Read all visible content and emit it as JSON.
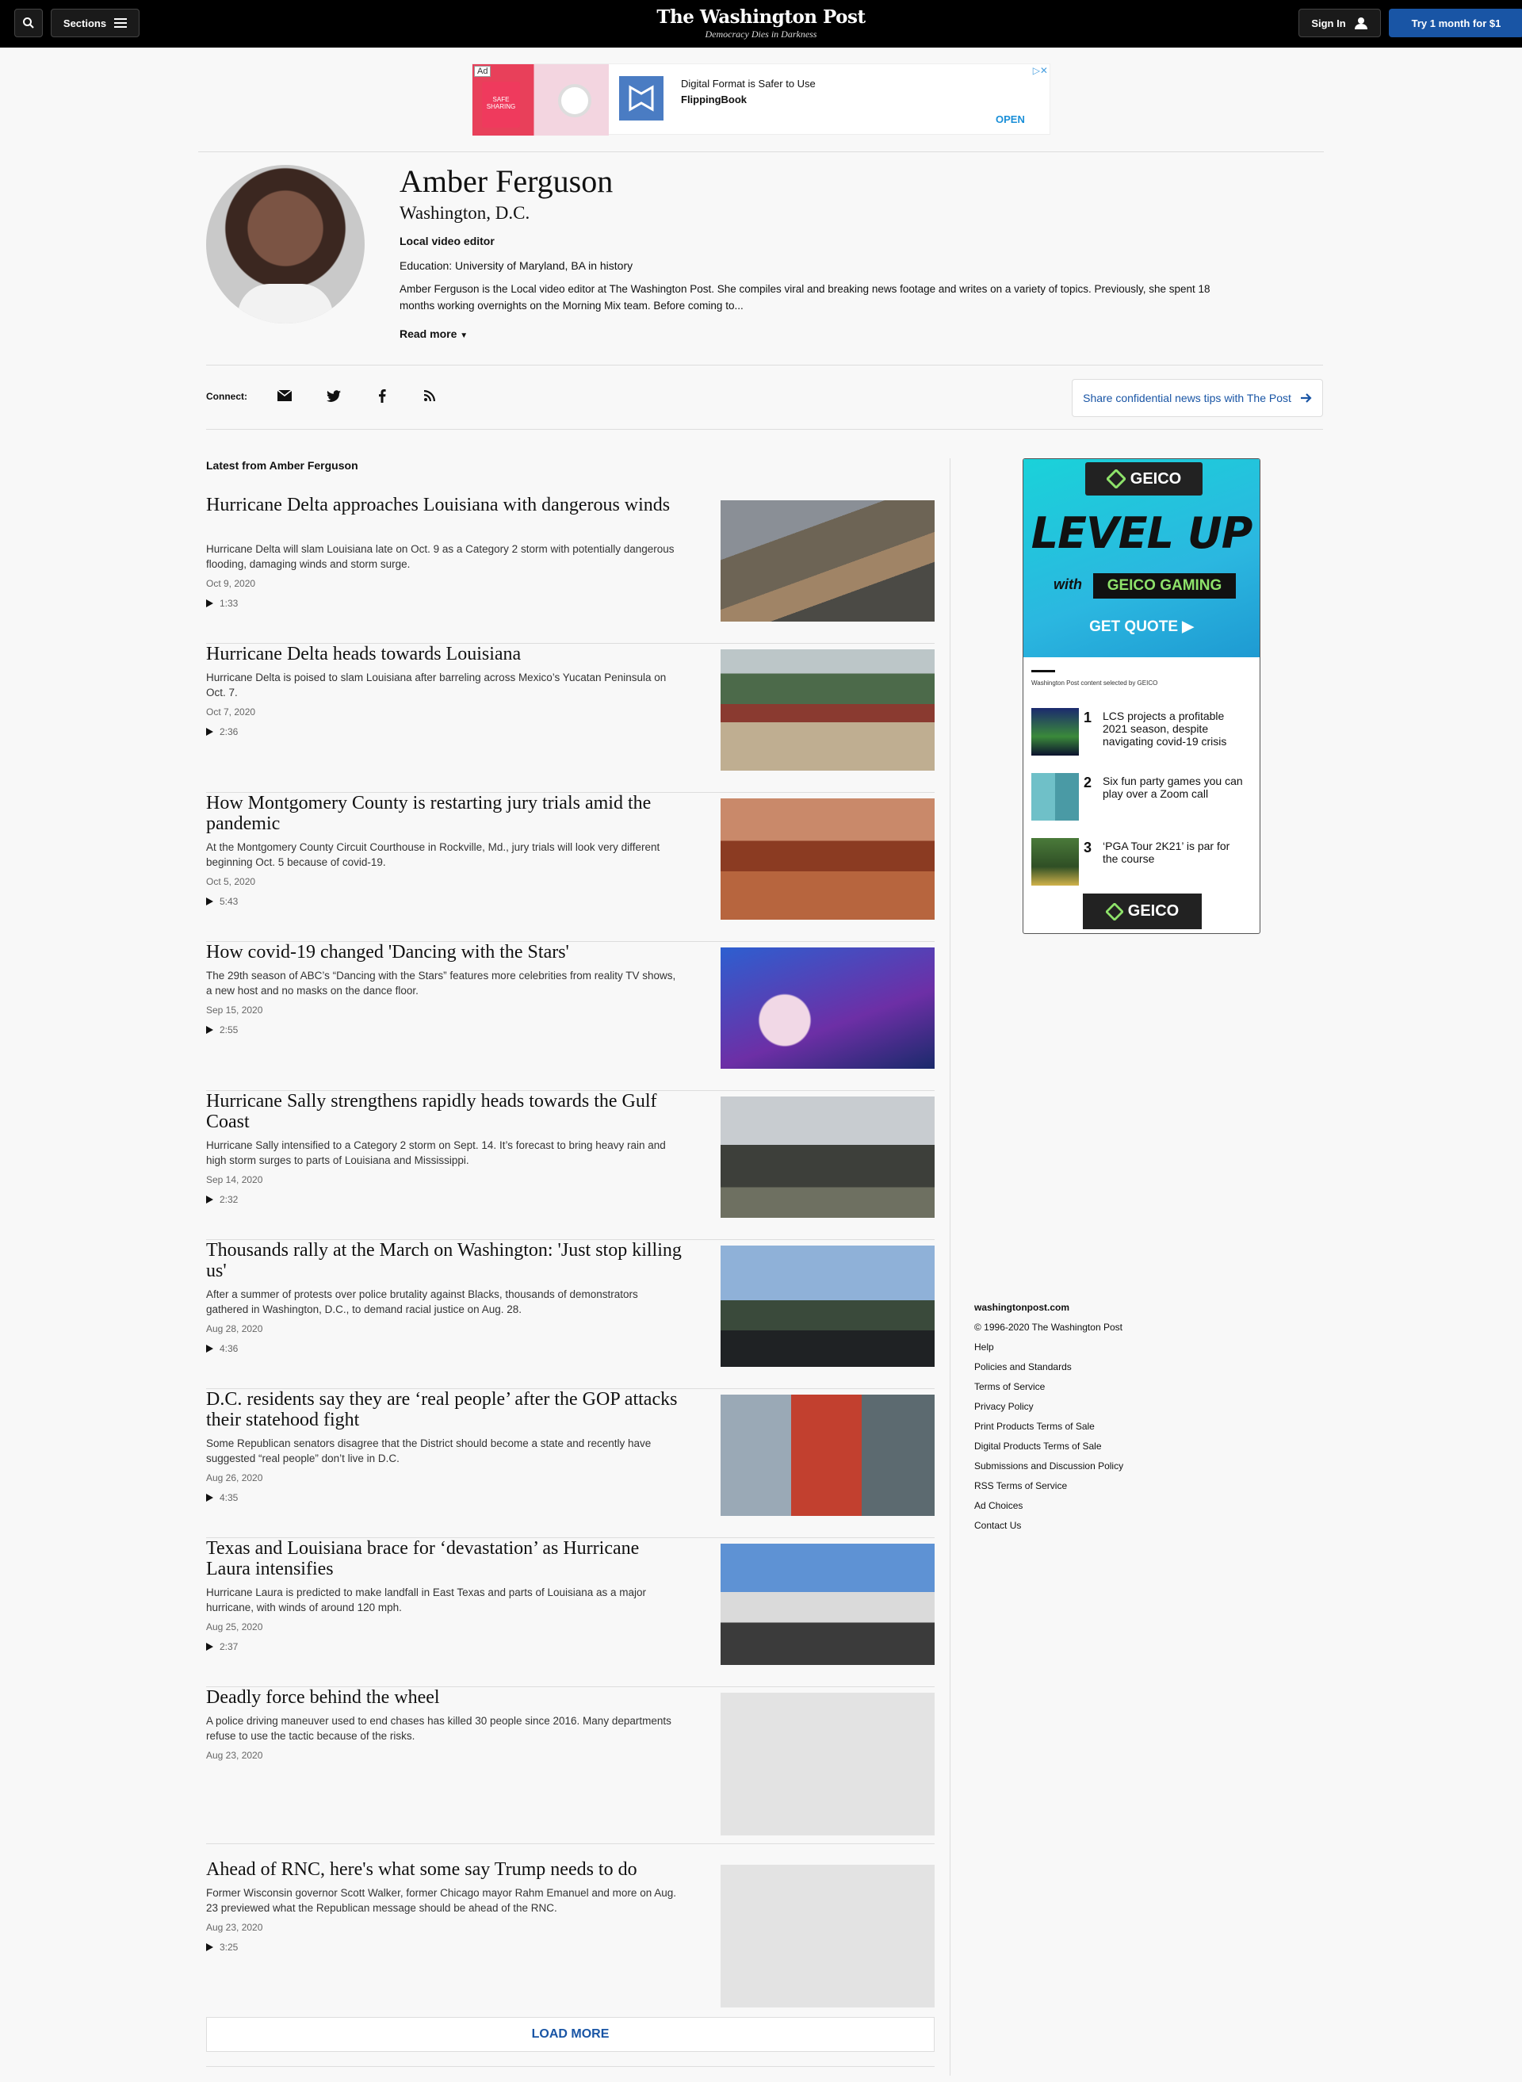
{
  "header": {
    "sections_label": "Sections",
    "logo": "The Washington Post",
    "tagline": "Democracy Dies in Darkness",
    "signin_label": "Sign In",
    "try_label": "Try 1 month for $1"
  },
  "top_ad": {
    "ad_label": "Ad",
    "card_text": "SAFE SHARING",
    "headline": "Digital Format is Safer to Use",
    "brand": "FlippingBook",
    "cta": "OPEN",
    "close": "▷✕"
  },
  "profile": {
    "name": "Amber Ferguson",
    "location": "Washington, D.C.",
    "role": "Local video editor",
    "education": "Education: University of Maryland, BA in history",
    "bio": "Amber Ferguson is the Local video editor at The Washington Post. She compiles viral and breaking news footage and writes on a variety of topics. Previously, she spent 18 months working overnights on the Morning Mix team. Before coming to...",
    "read_more": "Read more"
  },
  "connect": {
    "label": "Connect:",
    "tips_label": "Share confidential news tips with The Post"
  },
  "latest_title": "Latest from Amber Ferguson",
  "articles": [
    {
      "title": "Hurricane Delta approaches Louisiana with dangerous winds",
      "summary": "Hurricane Delta will slam Louisiana late on Oct. 9 as a Category 2 storm with potentially dangerous flooding, damaging winds and storm surge.",
      "date": "Oct 9, 2020",
      "duration": "1:33"
    },
    {
      "title": "Hurricane Delta heads towards Louisiana",
      "summary": "Hurricane Delta is poised to slam Louisiana after barreling across Mexico’s Yucatan Peninsula on Oct. 7.",
      "date": "Oct 7, 2020",
      "duration": "2:36"
    },
    {
      "title": "How Montgomery County is restarting jury trials amid the pandemic",
      "summary": "At the Montgomery County Circuit Courthouse in Rockville, Md., jury trials will look very different beginning Oct. 5 because of covid-19.",
      "date": "Oct 5, 2020",
      "duration": "5:43"
    },
    {
      "title": "How covid-19 changed 'Dancing with the Stars'",
      "summary": "The 29th season of ABC’s “Dancing with the Stars” features more celebrities from reality TV shows, a new host and no masks on the dance floor.",
      "date": "Sep 15, 2020",
      "duration": "2:55"
    },
    {
      "title": "Hurricane Sally strengthens rapidly heads towards the Gulf Coast",
      "summary": "Hurricane Sally intensified to a Category 2 storm on Sept. 14. It’s forecast to bring heavy rain and high storm surges to parts of Louisiana and Mississippi.",
      "date": "Sep 14, 2020",
      "duration": "2:32"
    },
    {
      "title": "Thousands rally at the March on Washington: 'Just stop killing us'",
      "summary": "After a summer of protests over police brutality against Blacks, thousands of demonstrators gathered in Washington, D.C., to demand racial justice on Aug. 28.",
      "date": "Aug 28, 2020",
      "duration": "4:36"
    },
    {
      "title": "D.C. residents say they are ‘real people’ after the GOP attacks their statehood fight",
      "summary": "Some Republican senators disagree that the District should become a state and recently have suggested “real people” don’t live in D.C.",
      "date": "Aug 26, 2020",
      "duration": "4:35"
    },
    {
      "title": "Texas and Louisiana brace for ‘devastation’ as Hurricane Laura intensifies",
      "summary": "Hurricane Laura is predicted to make landfall in East Texas and parts of Louisiana as a major hurricane, with winds of around 120 mph.",
      "date": "Aug 25, 2020",
      "duration": "2:37"
    },
    {
      "title": "Deadly force behind the wheel",
      "summary": "A police driving maneuver used to end chases has killed 30 people since 2016. Many departments refuse to use the tactic because of the risks.",
      "date": "Aug 23, 2020",
      "duration": ""
    },
    {
      "title": "Ahead of RNC, here's what some say Trump needs to do",
      "summary": "Former Wisconsin governor Scott Walker, former Chicago mayor Rahm Emanuel and more on Aug. 23 previewed what the Republican message should be ahead of the RNC.",
      "date": "Aug 23, 2020",
      "duration": "3:25"
    }
  ],
  "load_more": "LOAD MORE",
  "side_ad": {
    "brand": "GEICO",
    "brand_sub": "GAMING",
    "headline": "LEVEL UP",
    "with": "with",
    "geico_gaming": "GEICO GAMING",
    "cta": "GET QUOTE ▶",
    "selected_by": "Washington Post content selected by GEICO",
    "items": [
      {
        "num": "1",
        "text": "LCS projects a profitable 2021 season, despite navigating covid-19 crisis"
      },
      {
        "num": "2",
        "text": "Six fun party games you can play over a Zoom call"
      },
      {
        "num": "3",
        "text": "‘PGA Tour 2K21’ is par for the course"
      }
    ]
  },
  "footer": {
    "domain": "washingtonpost.com",
    "copyright": "© 1996-2020 The Washington Post",
    "links": [
      "Help",
      "Policies and Standards",
      "Terms of Service",
      "Privacy Policy",
      "Print Products Terms of Sale",
      "Digital Products Terms of Sale",
      "Submissions and Discussion Policy",
      "RSS Terms of Service",
      "Ad Choices",
      "Contact Us"
    ]
  },
  "colors": {
    "brand_blue": "#1955a5",
    "masthead_bg": "#000000",
    "geico_green": "#8ee26a"
  }
}
